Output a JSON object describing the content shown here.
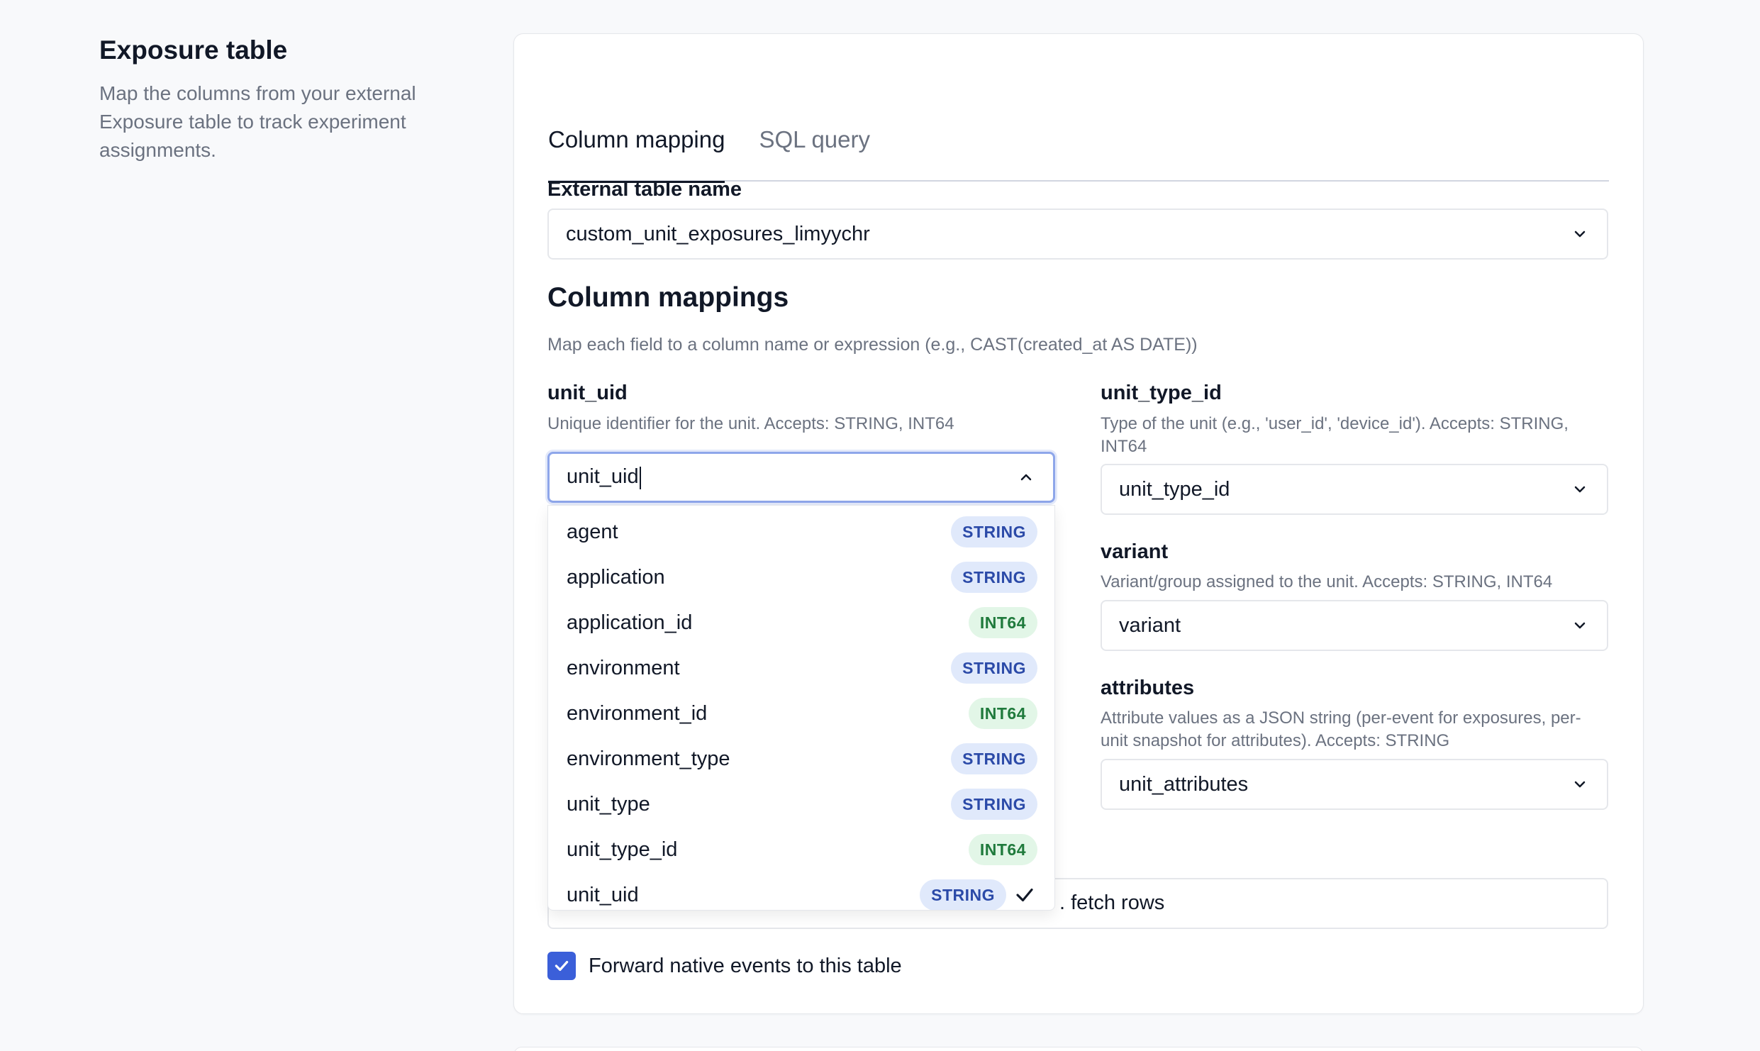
{
  "section": {
    "title": "Exposure table",
    "description": "Map the columns from your external Exposure table to track experiment assignments."
  },
  "tabs": [
    {
      "label": "Column mapping",
      "active": true
    },
    {
      "label": "SQL query",
      "active": false
    }
  ],
  "external_table": {
    "label": "External table name",
    "value": "custom_unit_exposures_limyychr"
  },
  "mappings": {
    "title": "Column mappings",
    "description": "Map each field to a column name or expression (e.g., CAST(created_at AS DATE))",
    "unit_uid": {
      "label": "unit_uid",
      "help": "Unique identifier for the unit. Accepts: STRING, INT64",
      "value": "unit_uid"
    },
    "unit_type_id": {
      "label": "unit_type_id",
      "help": "Type of the unit (e.g., 'user_id', 'device_id'). Accepts: STRING, INT64",
      "value": "unit_type_id"
    },
    "variant": {
      "label": "variant",
      "help": "Variant/group assigned to the unit. Accepts: STRING, INT64",
      "value": "variant"
    },
    "attributes": {
      "label": "attributes",
      "help": "Attribute values as a JSON string (per-event for exposures, per-unit snapshot for attributes). Accepts: STRING",
      "value": "unit_attributes"
    }
  },
  "dropdown_options": [
    {
      "name": "agent",
      "type": "STRING"
    },
    {
      "name": "application",
      "type": "STRING"
    },
    {
      "name": "application_id",
      "type": "INT64"
    },
    {
      "name": "environment",
      "type": "STRING"
    },
    {
      "name": "environment_id",
      "type": "INT64"
    },
    {
      "name": "environment_type",
      "type": "STRING"
    },
    {
      "name": "unit_type",
      "type": "STRING"
    },
    {
      "name": "unit_type_id",
      "type": "INT64"
    },
    {
      "name": "unit_uid",
      "type": "STRING",
      "selected": true
    }
  ],
  "fetch_label": ". fetch rows",
  "forward_checkbox": {
    "label": "Forward native events to this table",
    "checked": true
  },
  "colors": {
    "accent": "#3b5fd9",
    "string_badge_bg": "#e0e9fb",
    "string_badge_fg": "#2b4aa8",
    "int64_badge_bg": "#e2f6e7",
    "int64_badge_fg": "#1f7a3c"
  },
  "icons": {
    "chevron_down": "chevron-down-icon",
    "chevron_up": "chevron-up-icon",
    "check": "check-icon"
  }
}
